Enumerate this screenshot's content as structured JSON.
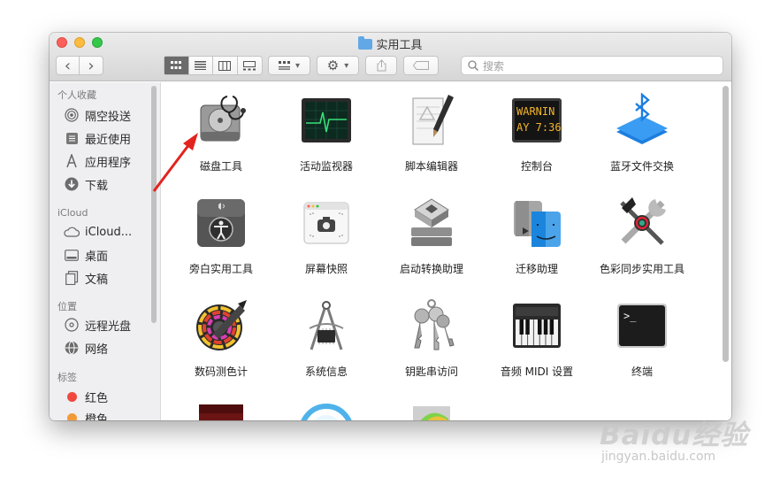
{
  "window": {
    "title": "实用工具"
  },
  "toolbar": {
    "back": "‹",
    "forward": "›",
    "view_modes": [
      "icon-view",
      "list-view",
      "column-view",
      "gallery-view"
    ],
    "group": "▾",
    "action": "▾",
    "search_placeholder": "搜索"
  },
  "sidebar": {
    "favorites_header": "个人收藏",
    "favorites": [
      {
        "label": "隔空投送",
        "icon": "airdrop-icon"
      },
      {
        "label": "最近使用",
        "icon": "recents-icon"
      },
      {
        "label": "应用程序",
        "icon": "applications-icon"
      },
      {
        "label": "下载",
        "icon": "downloads-icon"
      }
    ],
    "icloud_header": "iCloud",
    "icloud": [
      {
        "label": "iCloud...",
        "icon": "cloud-icon"
      },
      {
        "label": "桌面",
        "icon": "desktop-icon"
      },
      {
        "label": "文稿",
        "icon": "documents-icon"
      }
    ],
    "locations_header": "位置",
    "locations": [
      {
        "label": "远程光盘",
        "icon": "disc-icon"
      },
      {
        "label": "网络",
        "icon": "network-icon"
      }
    ],
    "tags_header": "标签",
    "tags": [
      {
        "label": "红色",
        "color": "#f0483e"
      },
      {
        "label": "橙色",
        "color": "#f29a38"
      }
    ]
  },
  "apps": [
    {
      "label": "磁盘工具",
      "icon": "disk-utility-icon"
    },
    {
      "label": "活动监视器",
      "icon": "activity-monitor-icon"
    },
    {
      "label": "脚本编辑器",
      "icon": "script-editor-icon"
    },
    {
      "label": "控制台",
      "icon": "console-icon",
      "screen_text_1": "WARNIN",
      "screen_text_2": "AY 7:36"
    },
    {
      "label": "蓝牙文件交换",
      "icon": "bluetooth-icon"
    },
    {
      "label": "旁白实用工具",
      "icon": "voiceover-icon"
    },
    {
      "label": "屏幕快照",
      "icon": "screenshot-icon"
    },
    {
      "label": "启动转换助理",
      "icon": "boot-camp-icon"
    },
    {
      "label": "迁移助理",
      "icon": "migration-assistant-icon"
    },
    {
      "label": "色彩同步实用工具",
      "icon": "colorsync-icon"
    },
    {
      "label": "数码测色计",
      "icon": "digital-color-meter-icon"
    },
    {
      "label": "系统信息",
      "icon": "system-information-icon"
    },
    {
      "label": "钥匙串访问",
      "icon": "keychain-icon"
    },
    {
      "label": "音频 MIDI 设置",
      "icon": "audio-midi-icon"
    },
    {
      "label": "终端",
      "icon": "terminal-icon",
      "prompt": ">_"
    },
    {
      "label": "",
      "icon": "grapher-partial-icon"
    },
    {
      "label": "",
      "icon": "podcast-partial-icon"
    },
    {
      "label": "",
      "icon": "chart-partial-icon"
    }
  ],
  "watermark": {
    "main": "Baidu经验",
    "sub": "jingyan.baidu.com"
  }
}
